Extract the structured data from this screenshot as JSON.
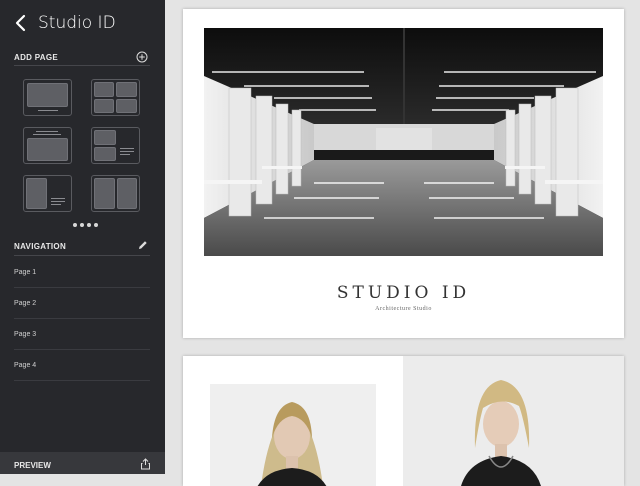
{
  "sidebar": {
    "title": "Studio ID",
    "back_icon": "chevron-left-icon",
    "add_page": {
      "label": "ADD PAGE",
      "add_icon": "plus-circle-icon",
      "templates": [
        "single-image",
        "four-image-grid",
        "image-with-caption",
        "images-with-text",
        "image-text-columns",
        "portrait-images"
      ],
      "pager_dots": 4
    },
    "navigation": {
      "label": "NAVIGATION",
      "edit_icon": "pencil-icon",
      "items": [
        {
          "label": "Page 1"
        },
        {
          "label": "Page 2"
        },
        {
          "label": "Page 3"
        },
        {
          "label": "Page 4"
        }
      ]
    },
    "preview": {
      "label": "PREVIEW",
      "share_icon": "share-icon"
    }
  },
  "canvas": {
    "page1": {
      "brand": "STUDIO ID",
      "tagline": "Architecture Studio",
      "hero_image": "interior-hall-photo"
    },
    "page2": {
      "images": [
        "portrait-photo-1",
        "portrait-photo-2"
      ]
    }
  },
  "colors": {
    "sidebar_bg": "#27282c",
    "canvas_bg": "#e4e4e4",
    "page_bg": "#ffffff"
  }
}
